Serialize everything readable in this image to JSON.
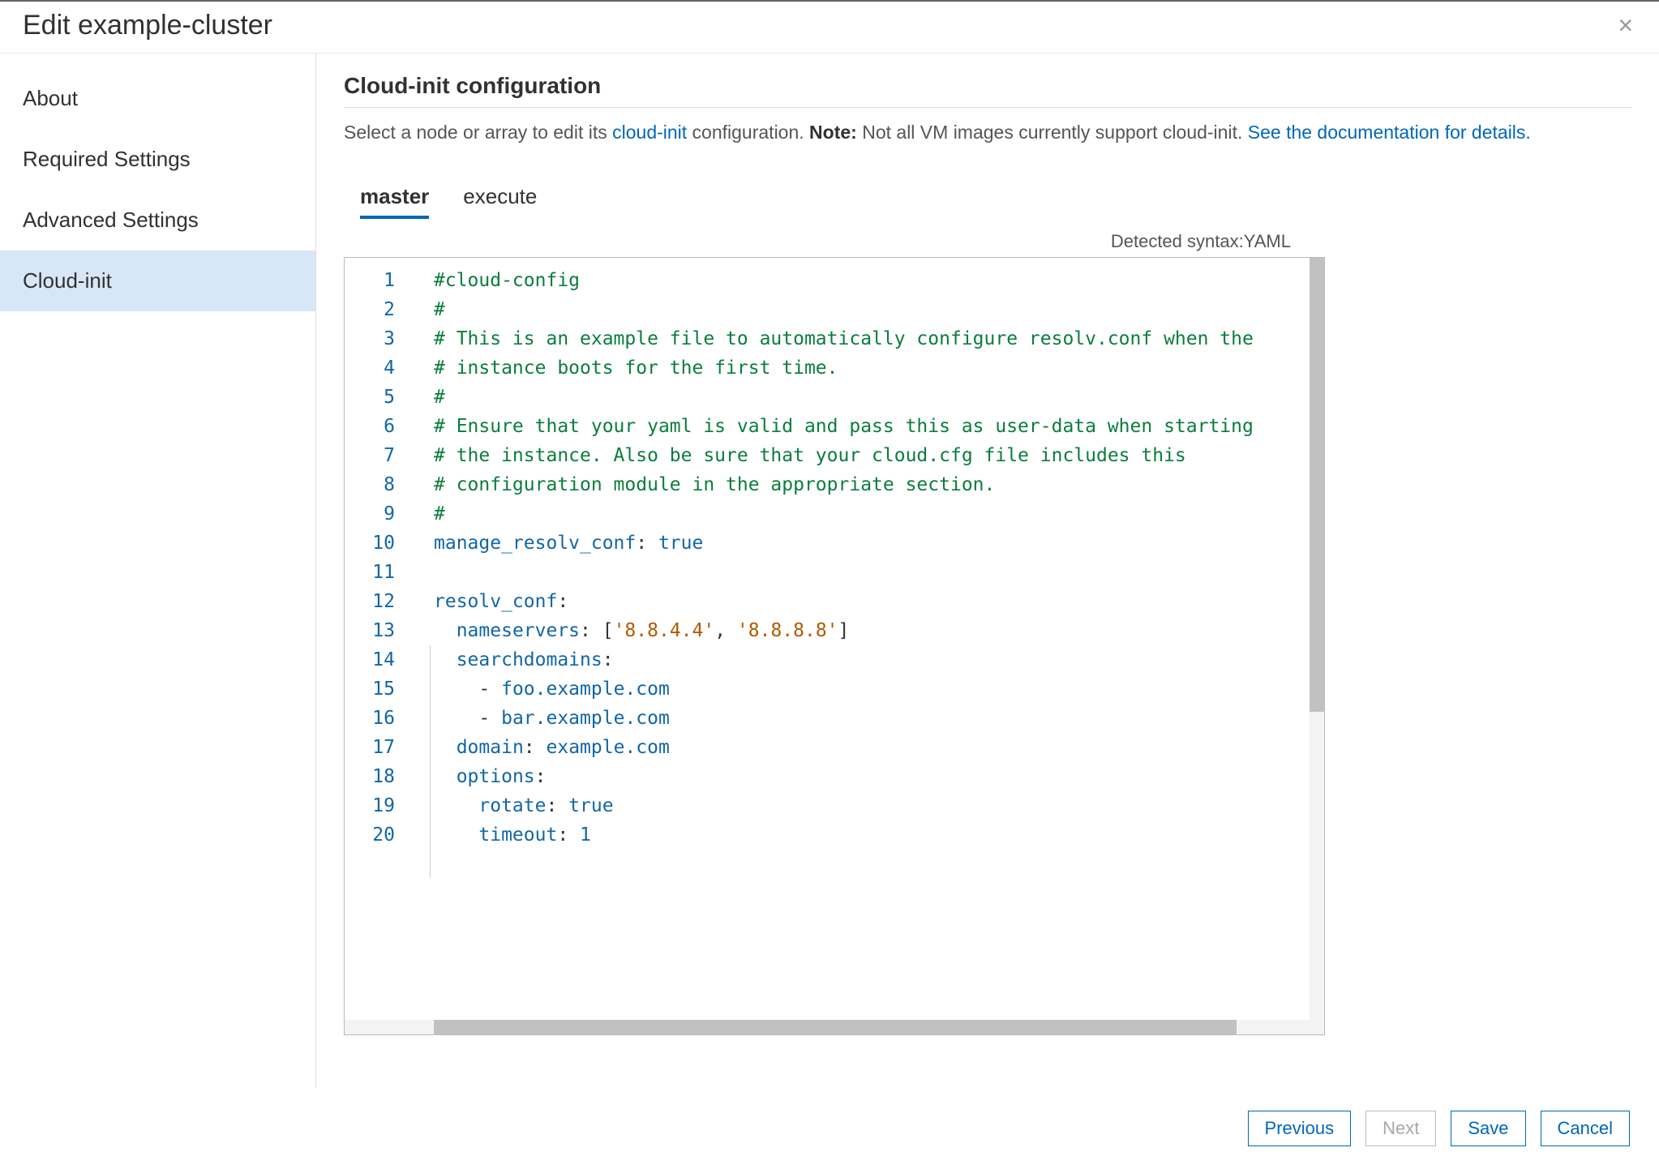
{
  "header": {
    "title": "Edit example-cluster"
  },
  "sidebar": {
    "items": [
      {
        "label": "About"
      },
      {
        "label": "Required Settings"
      },
      {
        "label": "Advanced Settings"
      },
      {
        "label": "Cloud-init"
      }
    ],
    "activeIndex": 3
  },
  "section": {
    "title": "Cloud-init configuration",
    "pre": "Select a node or array to edit its ",
    "link1": "cloud-init",
    "mid": " configuration. ",
    "noteLabel": "Note:",
    "noteText": " Not all VM images currently support cloud-init. ",
    "link2": "See the documentation for details."
  },
  "tabs": {
    "items": [
      "master",
      "execute"
    ],
    "activeIndex": 0
  },
  "syntax": {
    "label": "Detected syntax: ",
    "value": "YAML"
  },
  "editor": {
    "lineNumbers": [
      "1",
      "2",
      "3",
      "4",
      "5",
      "6",
      "7",
      "8",
      "9",
      "10",
      "11",
      "12",
      "13",
      "14",
      "15",
      "16",
      "17",
      "18",
      "19",
      "20"
    ],
    "lines": [
      [
        {
          "t": "#cloud-config",
          "c": "c-comment"
        }
      ],
      [
        {
          "t": "#",
          "c": "c-comment"
        }
      ],
      [
        {
          "t": "# This is an example file to automatically configure resolv.conf when the",
          "c": "c-comment"
        }
      ],
      [
        {
          "t": "# instance boots for the first time.",
          "c": "c-comment"
        }
      ],
      [
        {
          "t": "#",
          "c": "c-comment"
        }
      ],
      [
        {
          "t": "# Ensure that your yaml is valid and pass this as user-data when starting",
          "c": "c-comment"
        }
      ],
      [
        {
          "t": "# the instance. Also be sure that your cloud.cfg file includes this",
          "c": "c-comment"
        }
      ],
      [
        {
          "t": "# configuration module in the appropriate section.",
          "c": "c-comment"
        }
      ],
      [
        {
          "t": "#",
          "c": "c-comment"
        }
      ],
      [
        {
          "t": "manage_resolv_conf",
          "c": "c-key"
        },
        {
          "t": ": ",
          "c": "c-punc"
        },
        {
          "t": "true",
          "c": "c-bool"
        }
      ],
      [
        {
          "t": "",
          "c": ""
        }
      ],
      [
        {
          "t": "resolv_conf",
          "c": "c-key"
        },
        {
          "t": ":",
          "c": "c-punc"
        }
      ],
      [
        {
          "t": "  ",
          "c": ""
        },
        {
          "t": "nameservers",
          "c": "c-key"
        },
        {
          "t": ": [",
          "c": "c-punc"
        },
        {
          "t": "'8.8.4.4'",
          "c": "c-str"
        },
        {
          "t": ", ",
          "c": "c-punc"
        },
        {
          "t": "'8.8.8.8'",
          "c": "c-str"
        },
        {
          "t": "]",
          "c": "c-punc"
        }
      ],
      [
        {
          "t": "  ",
          "c": ""
        },
        {
          "t": "searchdomains",
          "c": "c-key"
        },
        {
          "t": ":",
          "c": "c-punc"
        }
      ],
      [
        {
          "t": "    - ",
          "c": "c-punc"
        },
        {
          "t": "foo.example.com",
          "c": "c-val"
        }
      ],
      [
        {
          "t": "    - ",
          "c": "c-punc"
        },
        {
          "t": "bar.example.com",
          "c": "c-val"
        }
      ],
      [
        {
          "t": "  ",
          "c": ""
        },
        {
          "t": "domain",
          "c": "c-key"
        },
        {
          "t": ": ",
          "c": "c-punc"
        },
        {
          "t": "example.com",
          "c": "c-val"
        }
      ],
      [
        {
          "t": "  ",
          "c": ""
        },
        {
          "t": "options",
          "c": "c-key"
        },
        {
          "t": ":",
          "c": "c-punc"
        }
      ],
      [
        {
          "t": "    ",
          "c": ""
        },
        {
          "t": "rotate",
          "c": "c-key"
        },
        {
          "t": ": ",
          "c": "c-punc"
        },
        {
          "t": "true",
          "c": "c-bool"
        }
      ],
      [
        {
          "t": "    ",
          "c": ""
        },
        {
          "t": "timeout",
          "c": "c-key"
        },
        {
          "t": ": ",
          "c": "c-punc"
        },
        {
          "t": "1",
          "c": "c-val"
        }
      ]
    ]
  },
  "footer": {
    "previous": "Previous",
    "next": "Next",
    "save": "Save",
    "cancel": "Cancel"
  }
}
